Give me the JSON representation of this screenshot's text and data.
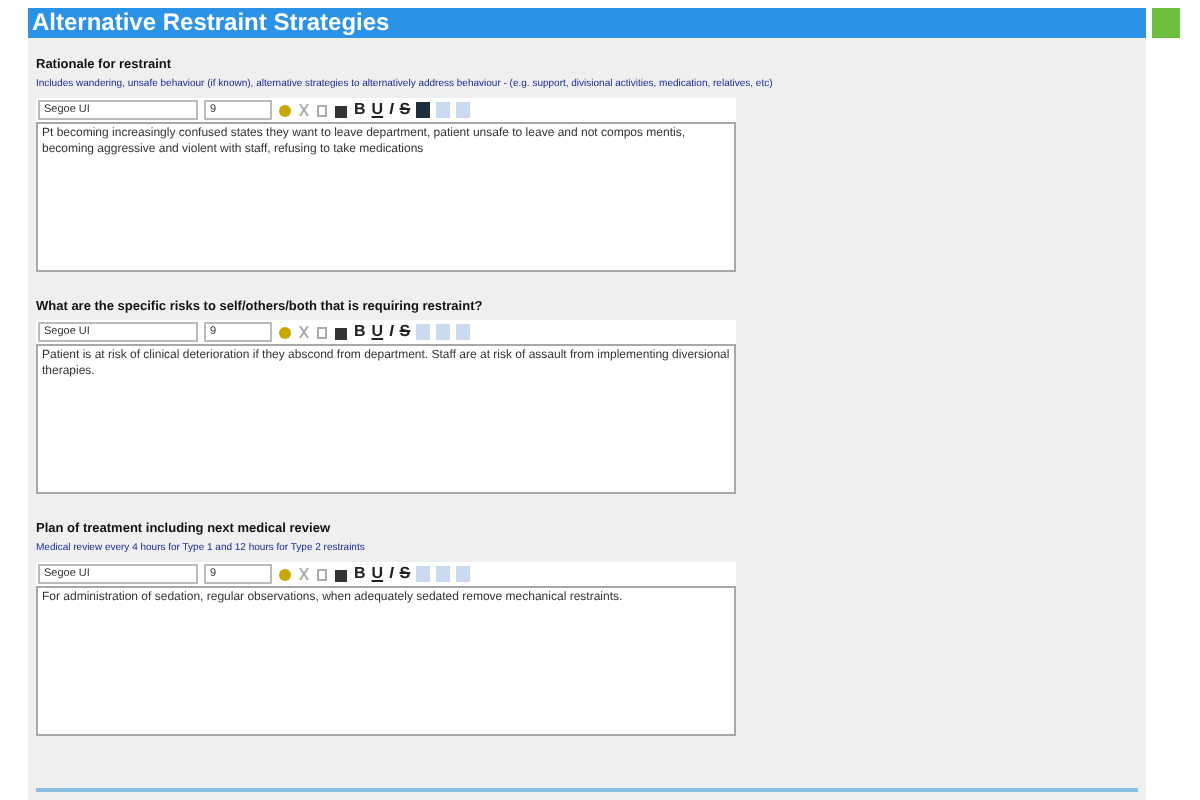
{
  "header": {
    "title": "Alternative Restraint Strategies"
  },
  "sections": [
    {
      "heading": "Rationale for restraint",
      "hint": "Includes wandering, unsafe behaviour (if known), alternative strategies to alternatively address behaviour - (e.g. support, divisional activities, medication, relatives, etc)",
      "font": "Segoe UI",
      "size": "9",
      "format_buttons": [
        "B",
        "U",
        "I",
        "S"
      ],
      "align_left_active": true,
      "text": "Pt becoming increasingly confused states they want to leave department, patient unsafe to leave and not compos mentis, becoming aggressive and violent with staff, refusing to take medications"
    },
    {
      "heading": "What are the specific risks to self/others/both that is requiring restraint?",
      "font": "Segoe UI",
      "size": "9",
      "format_buttons": [
        "B",
        "U",
        "I",
        "S"
      ],
      "align_left_active": false,
      "text": "Patient is at risk of clinical deterioration if they abscond from department. Staff are at risk of assault from implementing diversional therapies."
    },
    {
      "heading": "Plan of treatment including next medical review",
      "hint": "Medical review every 4 hours for Type 1 and 12 hours for Type 2 restraints",
      "font": "Segoe UI",
      "size": "9",
      "format_buttons": [
        "B",
        "U",
        "I",
        "S"
      ],
      "align_left_active": false,
      "text": "For administration of sedation, regular observations, when adequately sedated remove mechanical restraints."
    }
  ]
}
